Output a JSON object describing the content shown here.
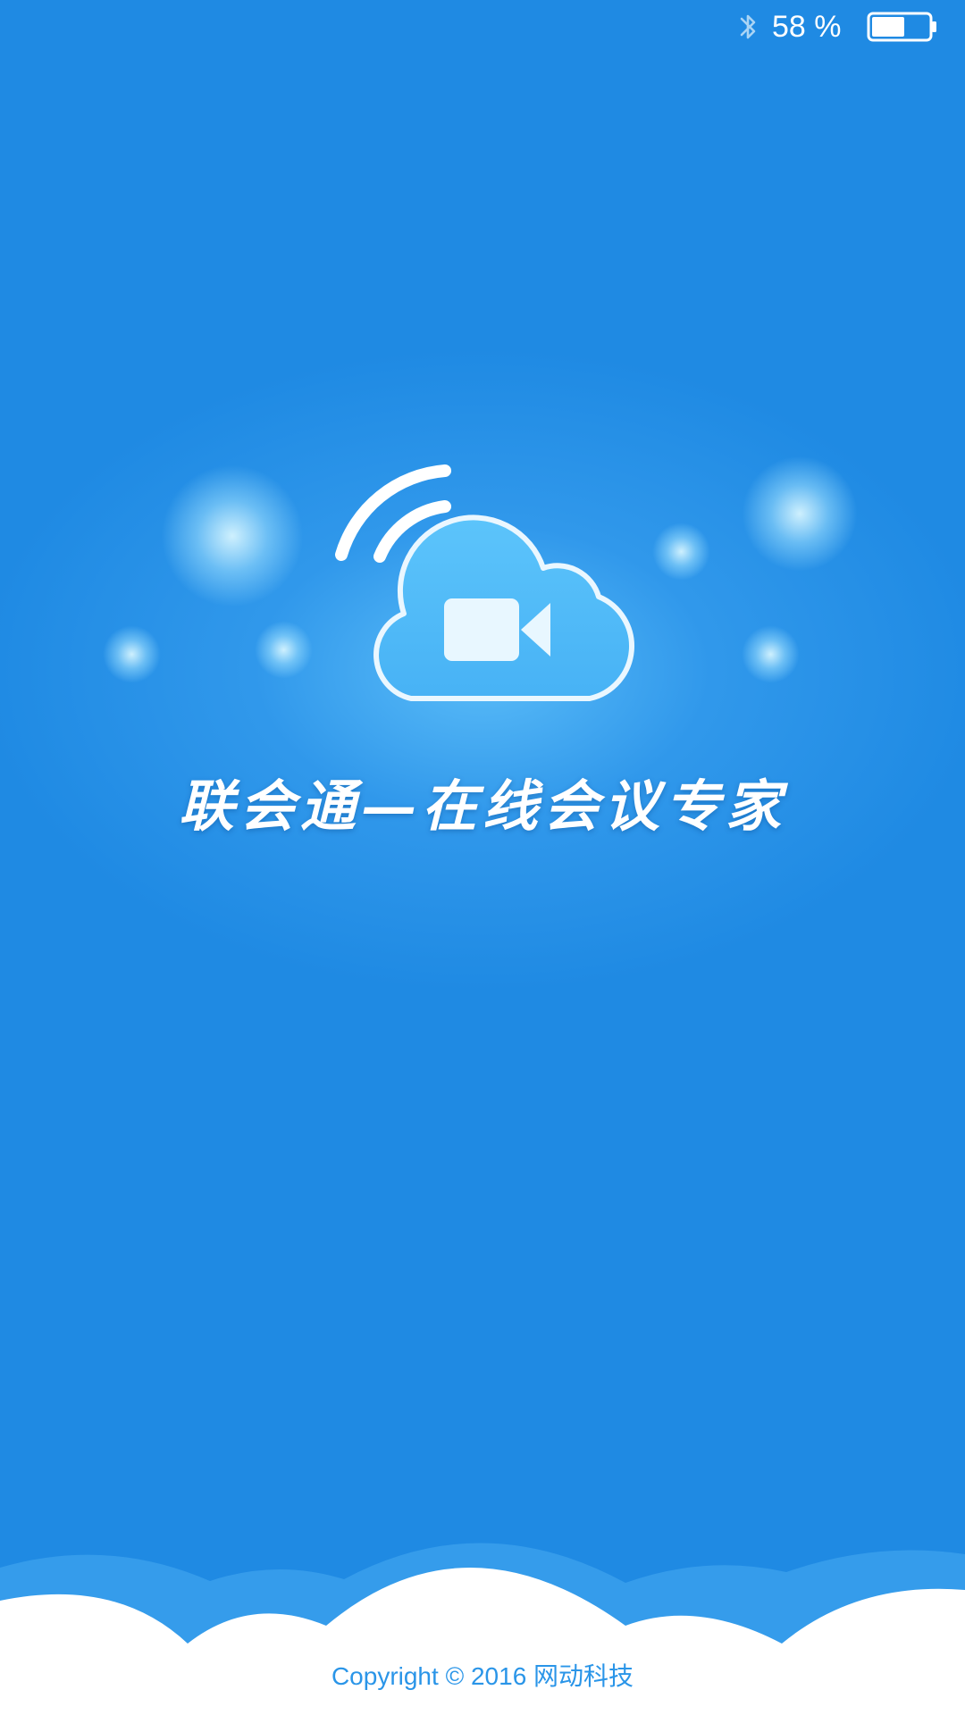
{
  "status_bar": {
    "battery_percent": "58 %",
    "battery_level": 0.58,
    "bluetooth_icon": "bluetooth-icon",
    "battery_icon": "battery-icon"
  },
  "splash": {
    "logo_icon": "cloud-video-camera-icon",
    "slogan": "联会通—在线会议专家",
    "copyright": "Copyright © 2016 网动科技"
  },
  "colors": {
    "background": "#1f8ae3",
    "glow": "#6ecdff",
    "text": "#ffffff",
    "copyright_text": "#2a95e8"
  }
}
